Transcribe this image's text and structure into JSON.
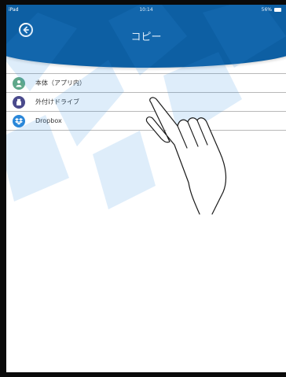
{
  "statusbar": {
    "device": "iPad",
    "time": "10:14",
    "battery": "56%"
  },
  "header": {
    "title": "コピー"
  },
  "items": [
    {
      "label": "本体（アプリ内）",
      "icon": "person-icon",
      "color": "#5fa88a"
    },
    {
      "label": "外付けドライブ",
      "icon": "usb-drive-icon",
      "color": "#4a4a8c"
    },
    {
      "label": "Dropbox",
      "icon": "dropbox-icon",
      "color": "#2a87d9"
    }
  ],
  "colors": {
    "header": "#0d5fa3",
    "background": "#ffffff",
    "divider": "#b8b8b8"
  }
}
